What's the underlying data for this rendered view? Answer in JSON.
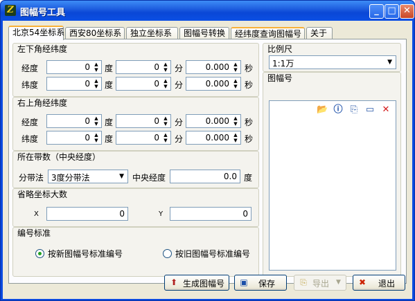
{
  "window": {
    "title": "图幅号工具",
    "icon_char": "Z"
  },
  "tabs": [
    "北京54坐标系",
    "西安80坐标系",
    "独立坐标系",
    "图幅号转换",
    "经纬度查询图幅号",
    "关于"
  ],
  "lower_left": {
    "legend": "左下角经纬度",
    "lon_label": "经度",
    "lat_label": "纬度",
    "deg": "度",
    "min": "分",
    "sec": "秒",
    "lon": {
      "d": "0",
      "m": "0",
      "s": "0.000"
    },
    "lat": {
      "d": "0",
      "m": "0",
      "s": "0.000"
    }
  },
  "upper_right": {
    "legend": "右上角经纬度",
    "lon_label": "经度",
    "lat_label": "纬度",
    "deg": "度",
    "min": "分",
    "sec": "秒",
    "lon": {
      "d": "0",
      "m": "0",
      "s": "0.000"
    },
    "lat": {
      "d": "0",
      "m": "0",
      "s": "0.000"
    }
  },
  "zone": {
    "legend": "所在带数（中央经度）",
    "method_label": "分带法",
    "method_value": "3度分带法",
    "meridian_label": "中央经度",
    "meridian_value": "0.0",
    "meridian_unit": "度"
  },
  "omit": {
    "legend": "省略坐标大数",
    "x_label": "X",
    "x_value": "0",
    "y_label": "Y",
    "y_value": "0"
  },
  "standard": {
    "legend": "编号标准",
    "new_label": "按新图幅号标准编号",
    "old_label": "按旧图幅号标准编号",
    "selected": "new"
  },
  "scale": {
    "legend": "比例尺",
    "value": "1:1万"
  },
  "sheet": {
    "legend": "图幅号"
  },
  "buttons": {
    "generate": "生成图幅号",
    "save": "保存",
    "export": "导出",
    "exit": "退出"
  },
  "colors": {
    "title_bar": "#0a4ae0",
    "tab_highlight": "#f8b138",
    "close_red": "#cc2200"
  }
}
